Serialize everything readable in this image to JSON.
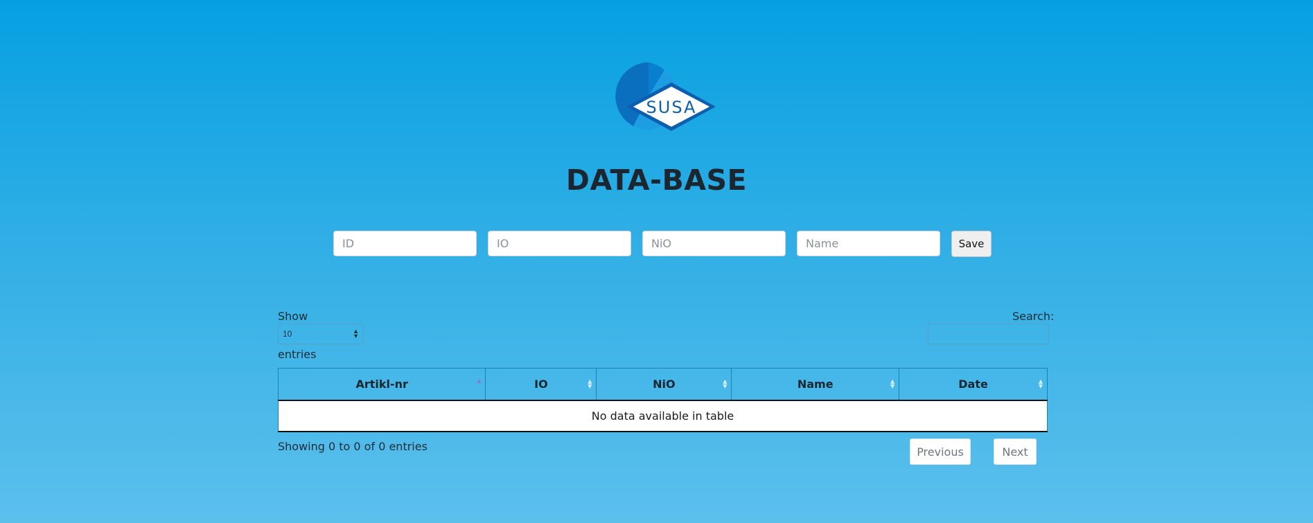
{
  "logo": {
    "text": "SUSA"
  },
  "title": "DATA-BASE",
  "form": {
    "id_placeholder": "ID",
    "io_placeholder": "IO",
    "nio_placeholder": "NiO",
    "name_placeholder": "Name",
    "save_label": "Save"
  },
  "table_controls": {
    "show_label": "Show",
    "entries_value": "10",
    "entries_label": "entries",
    "search_label": "Search:"
  },
  "table": {
    "columns": [
      "Artikl-nr",
      "IO",
      "NiO",
      "Name",
      "Date"
    ],
    "empty_message": "No data available in table"
  },
  "footer": {
    "info": "Showing 0 to 0 of 0 entries",
    "previous_label": "Previous",
    "next_label": "Next"
  },
  "colors": {
    "background_top": "#06a0e2",
    "background_bottom": "#5cc0ec",
    "logo_dark_blue": "#0b6fc0",
    "logo_light_blue": "#1a98e0"
  }
}
